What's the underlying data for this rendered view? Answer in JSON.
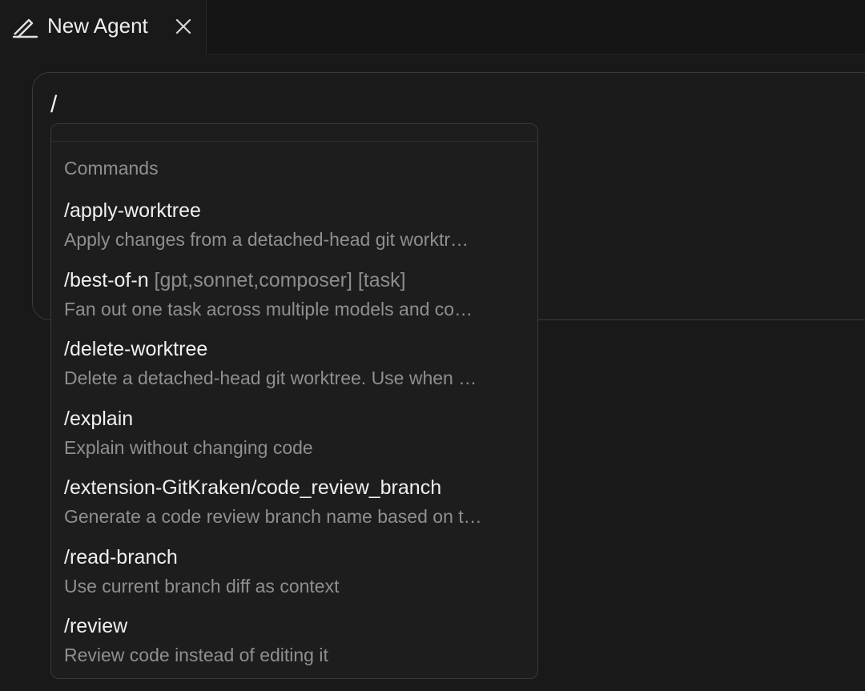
{
  "tab": {
    "title": "New Agent",
    "icon": "pencil-icon",
    "close_icon": "close-icon"
  },
  "composer": {
    "input_value": "/"
  },
  "dropdown": {
    "section_label": "Commands",
    "items": [
      {
        "command": "/apply-worktree",
        "args": "",
        "description": "Apply changes from a detached-head git worktr…"
      },
      {
        "command": "/best-of-n",
        "args": " [gpt,sonnet,composer] [task]",
        "description": "Fan out one task across multiple models and co…"
      },
      {
        "command": "/delete-worktree",
        "args": "",
        "description": "Delete a detached-head git worktree. Use when …"
      },
      {
        "command": "/explain",
        "args": "",
        "description": "Explain without changing code"
      },
      {
        "command": "/extension-GitKraken/code_review_branch",
        "args": "",
        "description": "Generate a code review branch name based on t…"
      },
      {
        "command": "/read-branch",
        "args": "",
        "description": "Use current branch diff as context"
      },
      {
        "command": "/review",
        "args": "",
        "description": "Review code instead of editing it"
      }
    ]
  }
}
